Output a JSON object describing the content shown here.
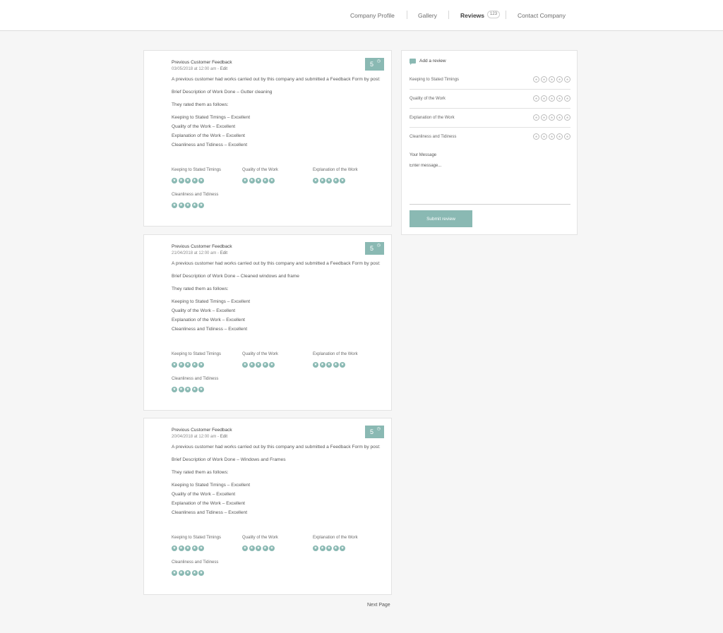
{
  "nav": {
    "items": [
      {
        "label": "Company Profile"
      },
      {
        "label": "Gallery"
      },
      {
        "label": "Reviews",
        "badge": "123"
      },
      {
        "label": "Contact Company"
      }
    ]
  },
  "reviews": [
    {
      "title": "Previous Customer Feedback",
      "date": "03/05/2018 at 12:00 am",
      "sep": " - ",
      "edit": "Edit",
      "score": "5",
      "intro": "A previous customer had works carried out by this company and submitted a Feedback Form by post:",
      "desc": "Brief Description of Work Done – Gutter cleaning",
      "rated": "They rated them as follows:",
      "lines": [
        "Keeping to Stated Timings – Excellent",
        "Quality of the Work – Excellent",
        "Explanation of the Work – Excellent",
        "Cleanliness and Tidiness – Excellent"
      ],
      "criteria": [
        {
          "label": "Keeping to Stated Timings",
          "stars": 5
        },
        {
          "label": "Quality of the Work",
          "stars": 5
        },
        {
          "label": "Explanation of the Work",
          "stars": 5
        },
        {
          "label": "Cleanliness and Tidiness",
          "stars": 5
        }
      ]
    },
    {
      "title": "Previous Customer Feedback",
      "date": "21/04/2018 at 12:00 am",
      "sep": " - ",
      "edit": "Edit",
      "score": "5",
      "intro": "A previous customer had works carried out by this company and submitted a Feedback Form by post:",
      "desc": "Brief Description of Work Done – Cleaned windows and frame",
      "rated": "They rated them as follows:",
      "lines": [
        "Keeping to Stated Timings – Excellent",
        "Quality of the Work – Excellent",
        "Explanation of the Work – Excellent",
        "Cleanliness and Tidiness – Excellent"
      ],
      "criteria": [
        {
          "label": "Keeping to Stated Timings",
          "stars": 5
        },
        {
          "label": "Quality of the Work",
          "stars": 5
        },
        {
          "label": "Explanation of the Work",
          "stars": 5
        },
        {
          "label": "Cleanliness and Tidiness",
          "stars": 5
        }
      ]
    },
    {
      "title": "Previous Customer Feedback",
      "date": "20/04/2018 at 12:00 am",
      "sep": " - ",
      "edit": "Edit",
      "score": "5",
      "intro": "A previous customer had works carried out by this company and submitted a Feedback Form by post:",
      "desc": "Brief Description of Work Done – Windows and Frames",
      "rated": "They rated them as follows:",
      "lines": [
        "Keeping to Stated Timings – Excellent",
        "Quality of the Work – Excellent",
        "Explanation of the Work – Excellent",
        "Cleanliness and Tidiness – Excellent"
      ],
      "criteria": [
        {
          "label": "Keeping to Stated Timings",
          "stars": 5
        },
        {
          "label": "Quality of the Work",
          "stars": 5
        },
        {
          "label": "Explanation of the Work",
          "stars": 5
        },
        {
          "label": "Cleanliness and Tidiness",
          "stars": 5
        }
      ]
    }
  ],
  "sidebar": {
    "add_review": "Add a review",
    "criteria": [
      "Keeping to Stated Timings",
      "Quality of the Work",
      "Explanation of the Work",
      "Cleanliness and Tidiness"
    ],
    "message_label": "Your Message",
    "message_placeholder": "Enter message...",
    "submit_label": "Submit review"
  },
  "pagination": {
    "next_label": "Next Page"
  },
  "colors": {
    "accent": "#8ab9b3"
  },
  "icons": {
    "star": "star-icon",
    "clock": "clock-icon",
    "comment": "comment-icon"
  }
}
